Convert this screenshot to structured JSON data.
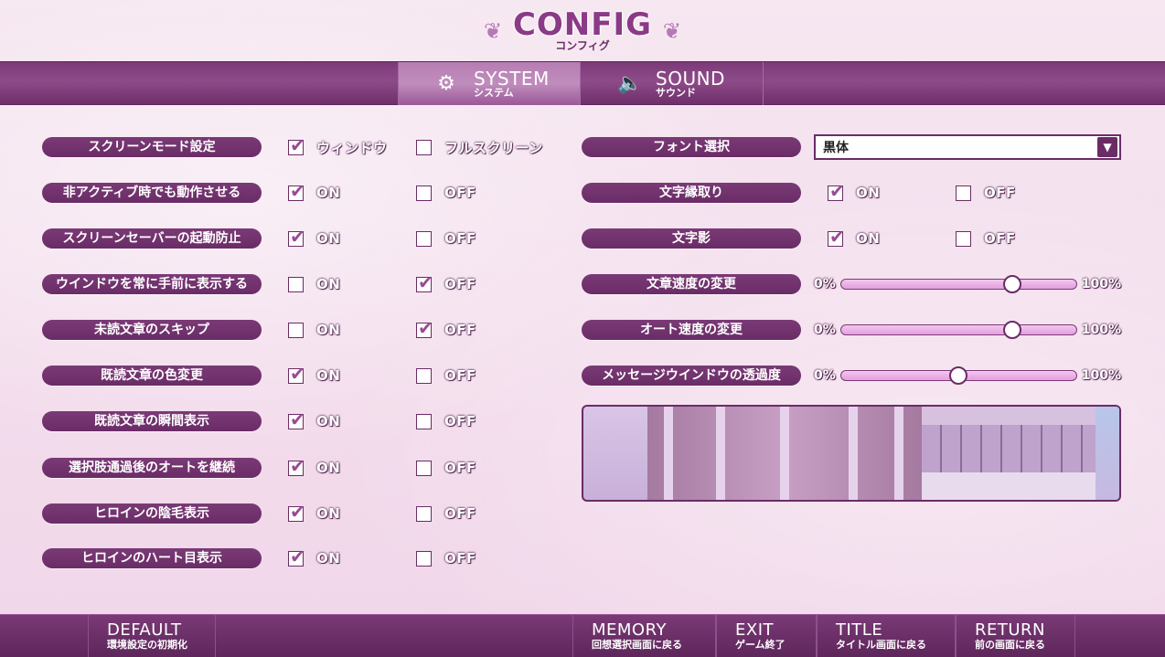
{
  "header": {
    "title": "CONFIG",
    "subtitle": "コンフィグ"
  },
  "tabs": [
    {
      "label": "SYSTEM",
      "sublabel": "システム",
      "icon": "gear-icon",
      "active": true
    },
    {
      "label": "SOUND",
      "sublabel": "サウンド",
      "icon": "speaker-icon",
      "active": false
    }
  ],
  "left_settings": [
    {
      "label": "スクリーンモード設定",
      "opt1": "ウィンドウ",
      "opt2": "フルスクリーン",
      "selected": 1
    },
    {
      "label": "非アクティブ時でも動作させる",
      "opt1": "ON",
      "opt2": "OFF",
      "selected": 1
    },
    {
      "label": "スクリーンセーバーの起動防止",
      "opt1": "ON",
      "opt2": "OFF",
      "selected": 1
    },
    {
      "label": "ウインドウを常に手前に表示する",
      "opt1": "ON",
      "opt2": "OFF",
      "selected": 2
    },
    {
      "label": "未読文章のスキップ",
      "opt1": "ON",
      "opt2": "OFF",
      "selected": 2
    },
    {
      "label": "既読文章の色変更",
      "opt1": "ON",
      "opt2": "OFF",
      "selected": 1
    },
    {
      "label": "既読文章の瞬間表示",
      "opt1": "ON",
      "opt2": "OFF",
      "selected": 1
    },
    {
      "label": "選択肢通過後のオートを継続",
      "opt1": "ON",
      "opt2": "OFF",
      "selected": 1
    },
    {
      "label": "ヒロインの陰毛表示",
      "opt1": "ON",
      "opt2": "OFF",
      "selected": 1
    },
    {
      "label": "ヒロインのハート目表示",
      "opt1": "ON",
      "opt2": "OFF",
      "selected": 1
    }
  ],
  "font": {
    "label": "フォント選択",
    "value": "黒体"
  },
  "right_toggles": [
    {
      "label": "文字縁取り",
      "opt1": "ON",
      "opt2": "OFF",
      "selected": 1
    },
    {
      "label": "文字影",
      "opt1": "ON",
      "opt2": "OFF",
      "selected": 1
    }
  ],
  "sliders": [
    {
      "label": "文章速度の変更",
      "min": "0%",
      "max": "100%",
      "value": 0.73
    },
    {
      "label": "オート速度の変更",
      "min": "0%",
      "max": "100%",
      "value": 0.73
    },
    {
      "label": "メッセージウインドウの透過度",
      "min": "0%",
      "max": "100%",
      "value": 0.5
    }
  ],
  "footer": [
    {
      "label": "DEFAULT",
      "sublabel": "環境設定の初期化"
    },
    {
      "label": "MEMORY",
      "sublabel": "回想選択画面に戻る"
    },
    {
      "label": "EXIT",
      "sublabel": "ゲーム終了"
    },
    {
      "label": "TITLE",
      "sublabel": "タイトル画面に戻る"
    },
    {
      "label": "RETURN",
      "sublabel": "前の画面に戻る"
    }
  ],
  "colors": {
    "accent": "#6a2c66",
    "tab_active": "#b77db3",
    "background": "#f3dcec"
  }
}
